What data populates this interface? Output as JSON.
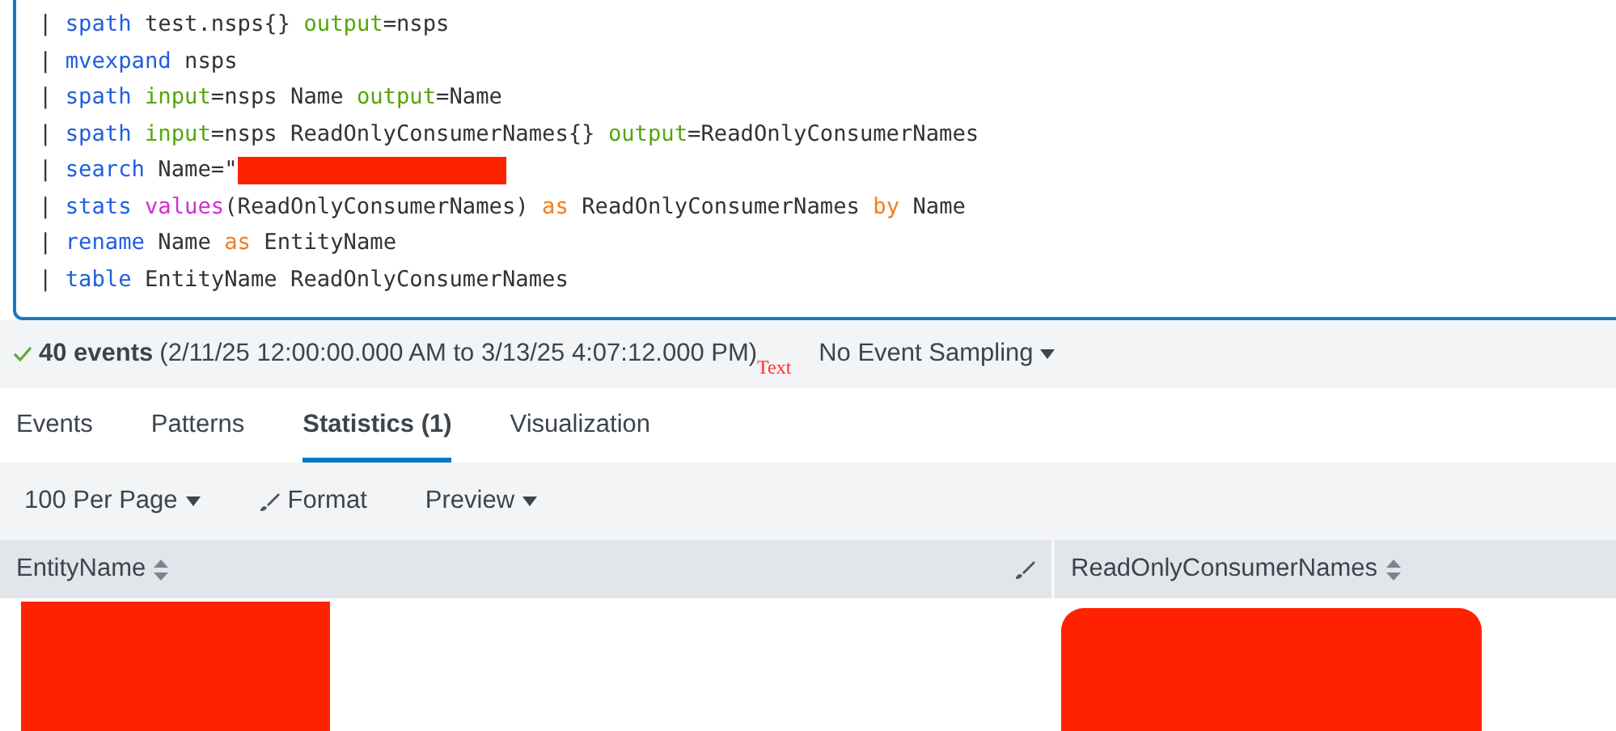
{
  "query_lines": [
    {
      "tokens": [
        {
          "kind": "pipe",
          "text": "|"
        },
        {
          "kind": "command",
          "text": "spath"
        },
        {
          "kind": "plain",
          "text": "test.nsps{}"
        },
        {
          "kind": "arg",
          "text": "output"
        },
        {
          "kind": "plain",
          "text": "=nsps",
          "attached": true
        }
      ]
    },
    {
      "tokens": [
        {
          "kind": "pipe",
          "text": "|"
        },
        {
          "kind": "command",
          "text": "mvexpand"
        },
        {
          "kind": "plain",
          "text": "nsps"
        }
      ]
    },
    {
      "tokens": [
        {
          "kind": "pipe",
          "text": "|"
        },
        {
          "kind": "command",
          "text": "spath"
        },
        {
          "kind": "arg",
          "text": "input"
        },
        {
          "kind": "plain",
          "text": "=nsps Name",
          "attached": true
        },
        {
          "kind": "arg",
          "text": "output"
        },
        {
          "kind": "plain",
          "text": "=Name",
          "attached": true
        }
      ]
    },
    {
      "tokens": [
        {
          "kind": "pipe",
          "text": "|"
        },
        {
          "kind": "command",
          "text": "spath"
        },
        {
          "kind": "arg",
          "text": "input"
        },
        {
          "kind": "plain",
          "text": "=nsps ReadOnlyConsumerNames{}",
          "attached": true
        },
        {
          "kind": "arg",
          "text": "output"
        },
        {
          "kind": "plain",
          "text": "=ReadOnlyConsumerNames",
          "attached": true
        }
      ]
    },
    {
      "tokens": [
        {
          "kind": "pipe",
          "text": "|"
        },
        {
          "kind": "command",
          "text": "search"
        },
        {
          "kind": "plain",
          "text": "Name=\""
        }
      ],
      "redacted": true
    },
    {
      "tokens": [
        {
          "kind": "pipe",
          "text": "|"
        },
        {
          "kind": "command",
          "text": "stats"
        },
        {
          "kind": "function",
          "text": "values"
        },
        {
          "kind": "plain",
          "text": "(ReadOnlyConsumerNames)",
          "attached": true
        },
        {
          "kind": "keyword",
          "text": "as"
        },
        {
          "kind": "plain",
          "text": "ReadOnlyConsumerNames"
        },
        {
          "kind": "keyword",
          "text": "by"
        },
        {
          "kind": "plain",
          "text": "Name"
        }
      ]
    },
    {
      "tokens": [
        {
          "kind": "pipe",
          "text": "|"
        },
        {
          "kind": "command",
          "text": "rename"
        },
        {
          "kind": "plain",
          "text": "Name"
        },
        {
          "kind": "keyword",
          "text": "as"
        },
        {
          "kind": "plain",
          "text": "EntityName"
        }
      ]
    },
    {
      "tokens": [
        {
          "kind": "pipe",
          "text": "|"
        },
        {
          "kind": "command",
          "text": "table"
        },
        {
          "kind": "plain",
          "text": "EntityName ReadOnlyConsumerNames"
        }
      ]
    }
  ],
  "status": {
    "complete": true,
    "count": "40 events",
    "range": "(2/11/25 12:00:00.000 AM to 3/13/25 4:07:12.000 PM)",
    "annotation": "Text",
    "sampling": "No Event Sampling"
  },
  "tabs": [
    {
      "label": "Events",
      "selected": false
    },
    {
      "label": "Patterns",
      "selected": false
    },
    {
      "label": "Statistics (1)",
      "selected": true
    },
    {
      "label": "Visualization",
      "selected": false
    }
  ],
  "toolbar": [
    {
      "kind": "dropdown",
      "label": "100 Per Page"
    },
    {
      "kind": "format",
      "label": "Format"
    },
    {
      "kind": "dropdown",
      "label": "Preview"
    }
  ],
  "table": {
    "columns": [
      {
        "label": "EntityName",
        "editable": true
      },
      {
        "label": "ReadOnlyConsumerNames",
        "editable": false
      }
    ],
    "rows": [
      {
        "cells": [
          {
            "redacted": true
          },
          {
            "redacted": true
          }
        ]
      }
    ]
  }
}
